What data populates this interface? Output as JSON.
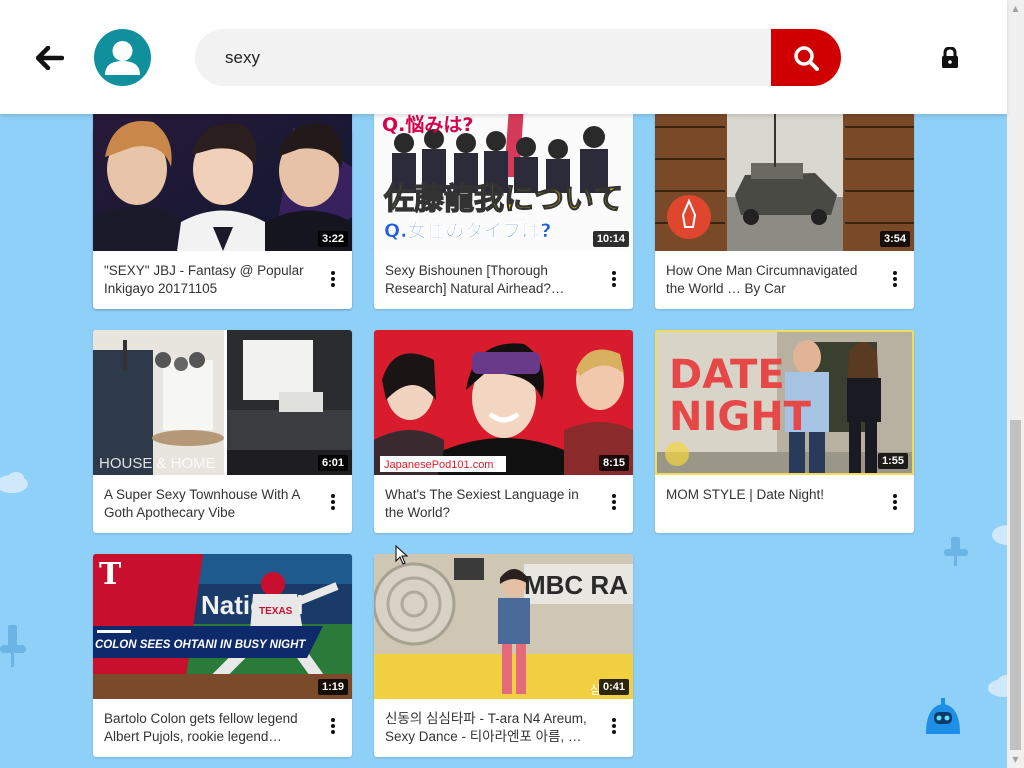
{
  "search": {
    "value": "sexy",
    "placeholder": ""
  },
  "videos": [
    {
      "title": "\"SEXY\" JBJ - Fantasy @ Popular Inkigayo 20171105",
      "duration": "3:22"
    },
    {
      "title": "Sexy Bishounen [Thorough Research] Natural Airhead? Let's…",
      "duration": "10:14"
    },
    {
      "title": "How One Man Circumnavigated the World … By Car",
      "duration": "3:54"
    },
    {
      "title": "A Super Sexy Townhouse With A Goth Apothecary Vibe",
      "duration": "6:01"
    },
    {
      "title": "What's The Sexiest Language in the World?",
      "duration": "8:15"
    },
    {
      "title": "MOM STYLE | Date Night!",
      "duration": "1:55"
    },
    {
      "title": "Bartolo Colon gets fellow legend Albert Pujols, rookie legend…",
      "duration": "1:19"
    },
    {
      "title": "신동의 심심타파 - T-ara N4 Areum, Sexy Dance - 티아라엔포 아름, …",
      "duration": "0:41"
    }
  ],
  "thumb_text": {
    "v2_top": "Q.悩みは?",
    "v2_main": "佐藤龍我について",
    "v2_sub": "Q.女性のタイプは?",
    "v4_overlay": "HOUSE & HOME",
    "v5_logo": "JapanesePod101.com",
    "v6_line1": "DATE",
    "v6_line2": "NIGHT",
    "v7_logo": "T",
    "v7_banner": "COLON SEES OHTANI IN BUSY NIGHT",
    "v7_ad": "National",
    "v7_jersey": "TEXAS",
    "v8_sign": "MBC RA",
    "v8_corner": "심"
  },
  "colors": {
    "background": "#8fd0f8",
    "accent": "#d10000",
    "avatar": "#10909c"
  }
}
